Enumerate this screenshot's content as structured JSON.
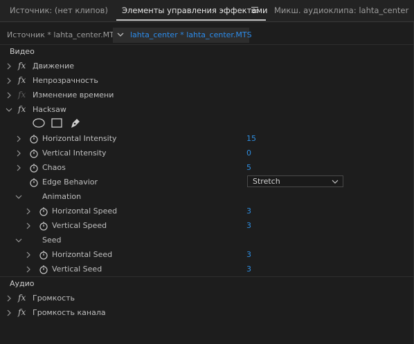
{
  "tabs": {
    "source": "Источник: (нет клипов)",
    "effect_controls": "Элементы управления эффектами",
    "audio_mixer": "Микш. аудиоклипа: lahta_center"
  },
  "source_bar": {
    "source_label": "Источник * lahta_center.MTS",
    "sequence_label": "lahta_center * lahta_center.MTS"
  },
  "sections": {
    "video": "Видео",
    "audio": "Аудио"
  },
  "effects": {
    "motion": "Движение",
    "opacity": "Непрозрачность",
    "time_remap": "Изменение времени",
    "hacksaw": "Hacksaw",
    "volume": "Громкость",
    "channel_volume": "Громкость канала"
  },
  "hacksaw": {
    "horizontal_intensity": {
      "label": "Horizontal Intensity",
      "value": "15"
    },
    "vertical_intensity": {
      "label": "Vertical Intensity",
      "value": "0"
    },
    "chaos": {
      "label": "Chaos",
      "value": "5"
    },
    "edge_behavior": {
      "label": "Edge Behavior",
      "value": "Stretch"
    },
    "animation": {
      "label": "Animation",
      "horizontal_speed": {
        "label": "Horizontal Speed",
        "value": "3"
      },
      "vertical_speed": {
        "label": "Vertical Speed",
        "value": "3"
      }
    },
    "seed": {
      "label": "Seed",
      "horizontal_seed": {
        "label": "Horizontal Seed",
        "value": "3"
      },
      "vertical_seed": {
        "label": "Vertical Seed",
        "value": "3"
      }
    }
  },
  "icons": {
    "mask_tools": [
      "ellipse-mask-icon",
      "rectangle-mask-icon",
      "pen-mask-icon"
    ]
  },
  "colors": {
    "value_blue": "#2f8ee0",
    "sequence_blue": "#2d8ceb"
  }
}
